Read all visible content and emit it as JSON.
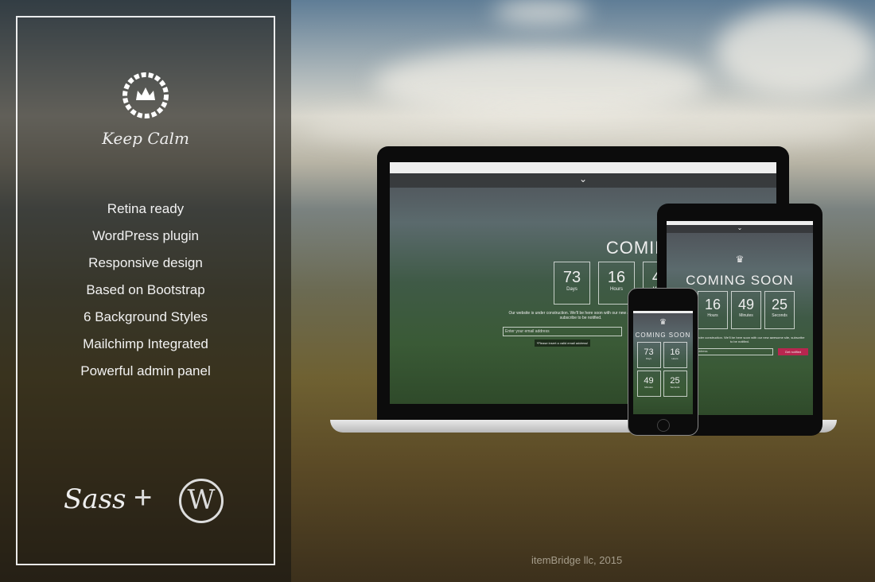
{
  "brand": {
    "name": "Keep Calm"
  },
  "features": [
    "Retina ready",
    "WordPress plugin",
    "Responsive design",
    "Based on Bootstrap",
    "6 Background Styles",
    "Mailchimp Integrated",
    "Powerful admin panel"
  ],
  "tech": {
    "sass": "Sass",
    "plus": "+",
    "wordpress": "W"
  },
  "copyright": "itemBridge llc, 2015",
  "preview": {
    "title": "COMING SOON",
    "countdown": [
      {
        "value": "73",
        "label": "Days"
      },
      {
        "value": "16",
        "label": "Hours"
      },
      {
        "value": "49",
        "label": "Minutes"
      },
      {
        "value": "25",
        "label": "Seconds"
      }
    ],
    "message": "Our website is under construction. We'll be here soon with our new awesome site, subscribe to be notified.",
    "email_placeholder": "Enter your email address",
    "error": "*Please insert a valid email address!",
    "notify_button": "Get notified",
    "accent": "#b8264f"
  }
}
